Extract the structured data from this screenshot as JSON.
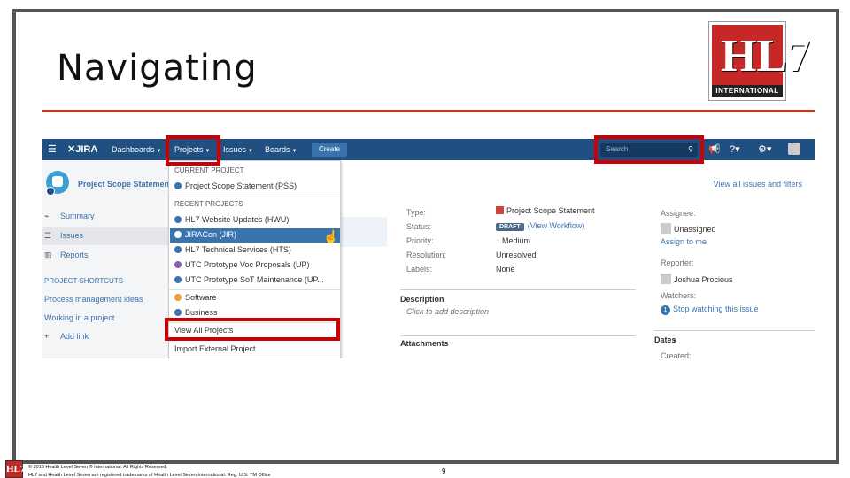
{
  "slide": {
    "title": "Navigating",
    "logo_mark": "HL7",
    "logo_text": "INTERNATIONAL",
    "footer_line1": "© 2018 Health Level Seven ® International. All Rights Reserved.",
    "footer_line2": "HL7 and Health Level Seven are registered trademarks of Health Level Seven International. Reg. U.S. TM Office",
    "page_number": "9",
    "accent_color": "#c0391b"
  },
  "navbar": {
    "brand": "JIRA",
    "items": [
      {
        "label": "Dashboards"
      },
      {
        "label": "Projects"
      },
      {
        "label": "Issues"
      },
      {
        "label": "Boards"
      }
    ],
    "create_label": "Create",
    "search_placeholder": "Search",
    "color": "#205081"
  },
  "sidebar": {
    "project_name": "Project Scope Statement",
    "items": [
      {
        "label": "Summary",
        "icon": "pulse-icon"
      },
      {
        "label": "Issues",
        "icon": "list-icon"
      },
      {
        "label": "Reports",
        "icon": "chart-icon"
      }
    ],
    "shortcuts_heading": "PROJECT SHORTCUTS",
    "shortcuts": [
      {
        "label": "Process management ideas"
      },
      {
        "label": "Working in a project"
      }
    ],
    "add_link": "Add link"
  },
  "dropdown": {
    "current_heading": "CURRENT PROJECT",
    "current": "Project Scope Statement (PSS)",
    "recent_heading": "RECENT PROJECTS",
    "recent": [
      {
        "label": "HL7 Website Updates (HWU)"
      },
      {
        "label": "JIRACon (JIR)"
      },
      {
        "label": "HL7 Technical Services (HTS)"
      },
      {
        "label": "UTC Prototype Voc Proposals (UP)"
      },
      {
        "label": "UTC Prototype SoT Maintenance (UP..."
      }
    ],
    "categories": [
      {
        "label": "Software"
      },
      {
        "label": "Business"
      }
    ],
    "view_all": "View All Projects",
    "import": "Import External Project"
  },
  "issue": {
    "view_all_link": "View all issues and filters",
    "fields": [
      {
        "label": "Type:",
        "value": "Project Scope Statement"
      },
      {
        "label": "Status:",
        "value": "DRAFT",
        "extra": "(View Workflow)"
      },
      {
        "label": "Priority:",
        "value": "Medium"
      },
      {
        "label": "Resolution:",
        "value": "Unresolved"
      },
      {
        "label": "Labels:",
        "value": "None"
      }
    ],
    "description_heading": "Description",
    "description_placeholder": "Click to add description",
    "attachments_heading": "Attachments",
    "people": {
      "assignee_label": "Assignee:",
      "assignee": "Unassigned",
      "assign_to_me": "Assign to me",
      "reporter_label": "Reporter:",
      "reporter": "Joshua Procious",
      "watchers_label": "Watchers:",
      "watch_count": "1",
      "watch_text": "Stop watching this issue"
    },
    "dates_heading": "Dates",
    "created_label": "Created:"
  }
}
